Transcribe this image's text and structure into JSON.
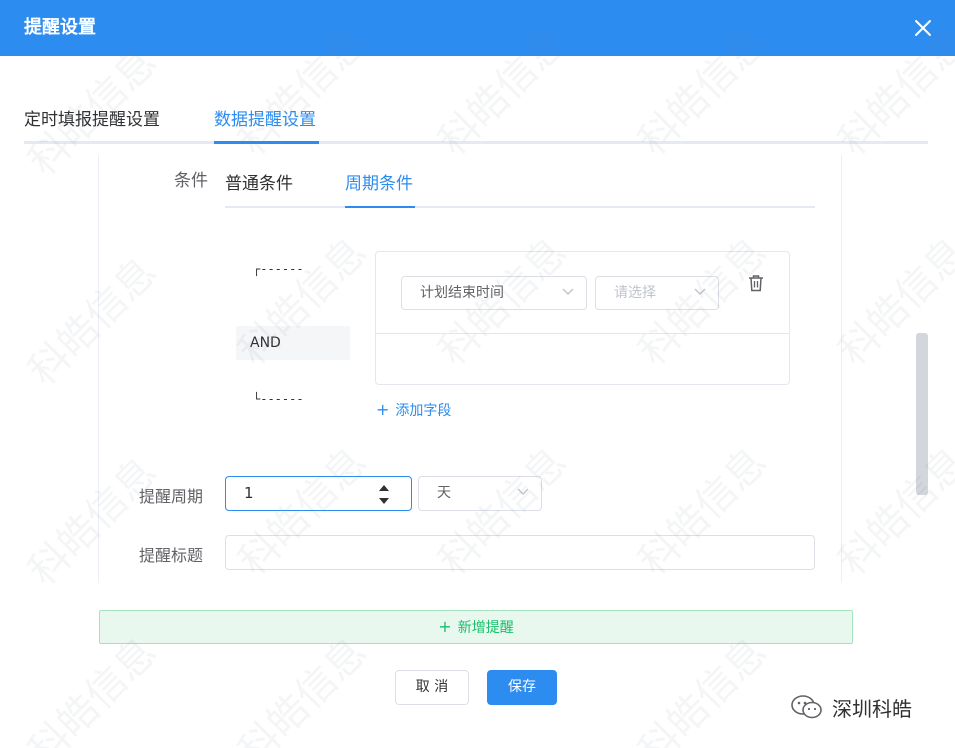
{
  "dialog": {
    "title": "提醒设置",
    "close_icon": "close-icon"
  },
  "top_tabs": [
    {
      "label": "定时填报提醒设置",
      "active": false
    },
    {
      "label": "数据提醒设置",
      "active": true
    }
  ],
  "condition": {
    "label": "条件",
    "tabs": [
      {
        "label": "普通条件",
        "active": false
      },
      {
        "label": "周期条件",
        "active": true
      }
    ],
    "logic_operator": "AND",
    "bracket_top": "┌------",
    "bracket_bottom": "└------",
    "field_select": {
      "value": "计划结束时间"
    },
    "operator_select": {
      "placeholder": "请选择"
    },
    "delete_icon": "trash-icon",
    "add_field_label": "添加字段"
  },
  "form": {
    "cycle_label": "提醒周期",
    "cycle_value": "1",
    "cycle_unit": "天",
    "title_label": "提醒标题",
    "title_value": ""
  },
  "add_reminder_label": "新增提醒",
  "buttons": {
    "cancel": "取 消",
    "save": "保存"
  },
  "brand": {
    "name": "深圳科皓"
  },
  "watermark_text": "科皓信息",
  "colors": {
    "primary": "#2d8cf0",
    "success": "#19be6b"
  }
}
